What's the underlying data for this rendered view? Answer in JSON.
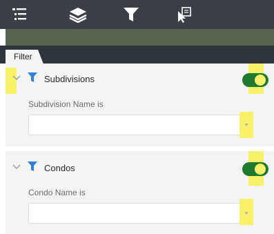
{
  "toolbar": {
    "icons": [
      "layer-list-icon",
      "layers-icon",
      "filter-icon",
      "select-icon"
    ]
  },
  "tab": {
    "label": "Filter"
  },
  "filters": [
    {
      "title": "Subdivisions",
      "field_label": "Subdivision Name is",
      "value": "",
      "enabled": true
    },
    {
      "title": "Condos",
      "field_label": "Condo Name is",
      "value": "",
      "enabled": true
    }
  ],
  "colors": {
    "toolbar": "#3b3f45",
    "toggle_on": "#1f7a2f",
    "highlight": "#f7f26a",
    "filter_icon": "#2f7fd6",
    "panel_bg": "#f3f3f3"
  }
}
